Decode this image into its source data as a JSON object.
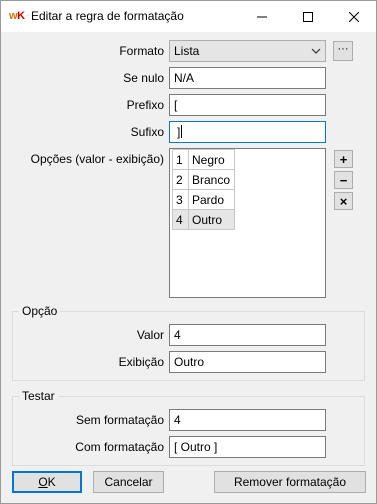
{
  "window": {
    "logo_w": "w",
    "logo_k": "K",
    "title": "Editar a regra de formatação"
  },
  "format": {
    "label": "Formato",
    "value": "Lista",
    "ellipsis": "···"
  },
  "if_null": {
    "label": "Se nulo",
    "value": "N/A"
  },
  "prefix": {
    "label": "Prefixo",
    "value": "["
  },
  "suffix": {
    "label": "Sufixo",
    "value": "]"
  },
  "options": {
    "label": "Opções (valor - exibição)",
    "items": [
      {
        "value": "1",
        "display": "Negro"
      },
      {
        "value": "2",
        "display": "Branco"
      },
      {
        "value": "3",
        "display": "Pardo"
      },
      {
        "value": "4",
        "display": "Outro"
      }
    ],
    "selected_index": 3,
    "add_symbol": "+",
    "remove_symbol": "−",
    "delete_symbol": "×"
  },
  "option_group": {
    "title": "Opção",
    "value_label": "Valor",
    "value": "4",
    "display_label": "Exibição",
    "display": "Outro"
  },
  "test_group": {
    "title": "Testar",
    "unformatted_label": "Sem formatação",
    "unformatted": "4",
    "formatted_label": "Com formatação",
    "formatted": "[ Outro ]"
  },
  "buttons": {
    "ok_underlined": "O",
    "ok_rest": "K",
    "cancel": "Cancelar",
    "remove_formatting": "Remover formatação"
  },
  "colors": {
    "focus_border": "#0078d7",
    "logo_w": "#e07000",
    "logo_k": "#d10000"
  }
}
